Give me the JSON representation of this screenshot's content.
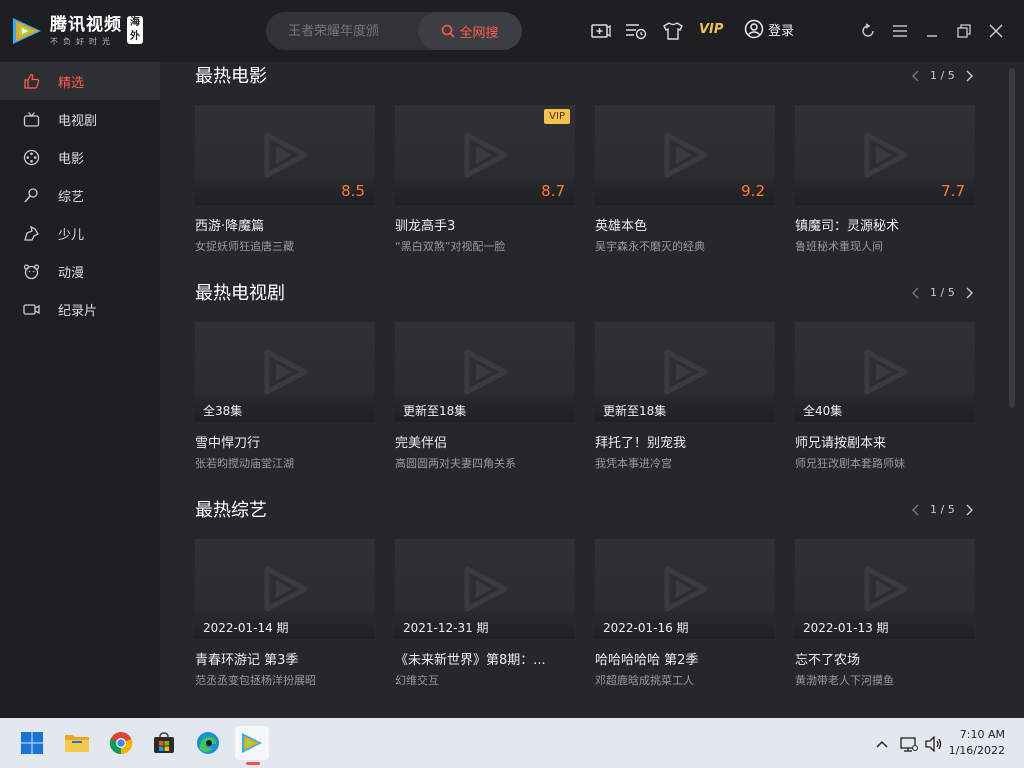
{
  "app": {
    "logo_name": "腾讯视频",
    "logo_slogan": "不负好时光",
    "logo_badge": "海外"
  },
  "search": {
    "placeholder": "王者荣耀年度颁",
    "button_label": "全网搜"
  },
  "header": {
    "vip_label": "VIP",
    "login_label": "登录"
  },
  "sidebar": {
    "items": [
      {
        "label": "精选",
        "icon": "thumb-up-icon",
        "active": true
      },
      {
        "label": "电视剧",
        "icon": "tv-icon"
      },
      {
        "label": "电影",
        "icon": "film-reel-icon"
      },
      {
        "label": "综艺",
        "icon": "microphone-icon"
      },
      {
        "label": "少儿",
        "icon": "kids-icon"
      },
      {
        "label": "动漫",
        "icon": "bear-icon"
      },
      {
        "label": "纪录片",
        "icon": "camera-icon"
      }
    ]
  },
  "sections": [
    {
      "title": "最热电影",
      "page": "1 / 5",
      "cards": [
        {
          "title": "西游·降魔篇",
          "subtitle": "女捉妖师狂追唐三藏",
          "score": "8.5"
        },
        {
          "title": "驯龙高手3",
          "subtitle": "“黑白双煞”对视配一脸",
          "score": "8.7",
          "badge": "VIP"
        },
        {
          "title": "英雄本色",
          "subtitle": "吴宇森永不磨灭的经典",
          "score": "9.2"
        },
        {
          "title": "镇魔司：灵源秘术",
          "subtitle": "鲁班秘术重现人间",
          "score": "7.7"
        }
      ]
    },
    {
      "title": "最热电视剧",
      "page": "1 / 5",
      "cards": [
        {
          "title": "雪中悍刀行",
          "subtitle": "张若昀搅动庙堂江湖",
          "overlay": "全38集"
        },
        {
          "title": "完美伴侣",
          "subtitle": "高圆圆两对夫妻四角关系",
          "overlay": "更新至18集"
        },
        {
          "title": "拜托了！别宠我",
          "subtitle": "我凭本事进冷宫",
          "overlay": "更新至18集"
        },
        {
          "title": "师兄请按剧本来",
          "subtitle": "师兄狂改剧本套路师妹",
          "overlay": "全40集"
        }
      ]
    },
    {
      "title": "最热综艺",
      "page": "1 / 5",
      "cards": [
        {
          "title": "青春环游记 第3季",
          "subtitle": "范丞丞变包拯杨洋扮展昭",
          "overlay": "2022-01-14 期"
        },
        {
          "title": "《未来新世界》第8期：...",
          "subtitle": "幻维交互",
          "overlay": "2021-12-31 期"
        },
        {
          "title": "哈哈哈哈哈 第2季",
          "subtitle": "邓超鹿晗成挑菜工人",
          "overlay": "2022-01-16 期"
        },
        {
          "title": "忘不了农场",
          "subtitle": "黄渤带老人下河摸鱼",
          "overlay": "2022-01-13 期"
        }
      ]
    }
  ],
  "taskbar": {
    "apps": [
      "windows-start-icon",
      "file-explorer-icon",
      "chrome-icon",
      "store-icon",
      "edge-icon",
      "tencent-video-icon"
    ],
    "time": "7:10 AM",
    "date": "1/16/2022"
  },
  "colors": {
    "accent": "#ff5a4a",
    "score": "#ff7a2e",
    "vip": "#f2c14e",
    "background": "#26272b",
    "sidebar": "#1e1f22"
  }
}
